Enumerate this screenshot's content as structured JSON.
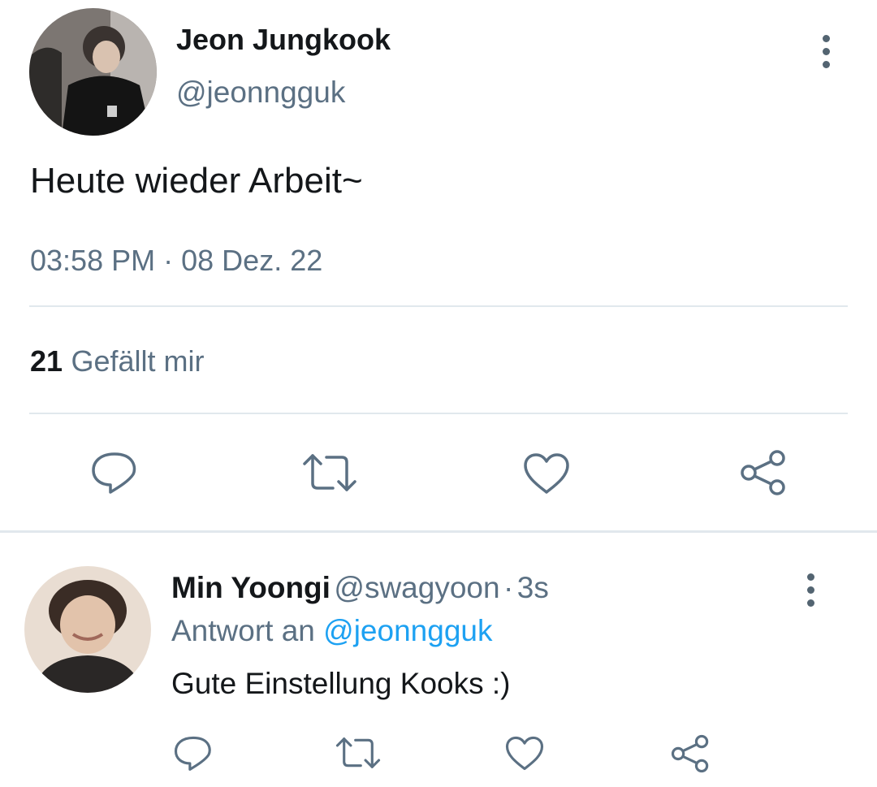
{
  "tweet": {
    "author": {
      "name": "Jeon Jungkook",
      "handle": "@jeonngguk"
    },
    "text": "Heute wieder Arbeit~",
    "time": "03:58 PM",
    "separator": "·",
    "date": "08 Dez. 22",
    "likes": {
      "count": "21",
      "label": "Gefällt mir"
    },
    "actions": [
      "reply-icon",
      "retweet-icon",
      "like-icon",
      "share-icon"
    ]
  },
  "reply": {
    "author": {
      "name": "Min Yoongi",
      "handle": "@swagyoon",
      "separator": "·",
      "time": "3s"
    },
    "replying_to_prefix": "Antwort an",
    "replying_to_handle": "@jeonngguk",
    "text": "Gute Einstellung Kooks :)",
    "actions": [
      "reply-icon",
      "retweet-icon",
      "like-icon",
      "share-icon"
    ]
  },
  "colors": {
    "text": "#14171a",
    "muted": "#5b7083",
    "link": "#1da1f2",
    "divider": "#e1e8ed"
  }
}
